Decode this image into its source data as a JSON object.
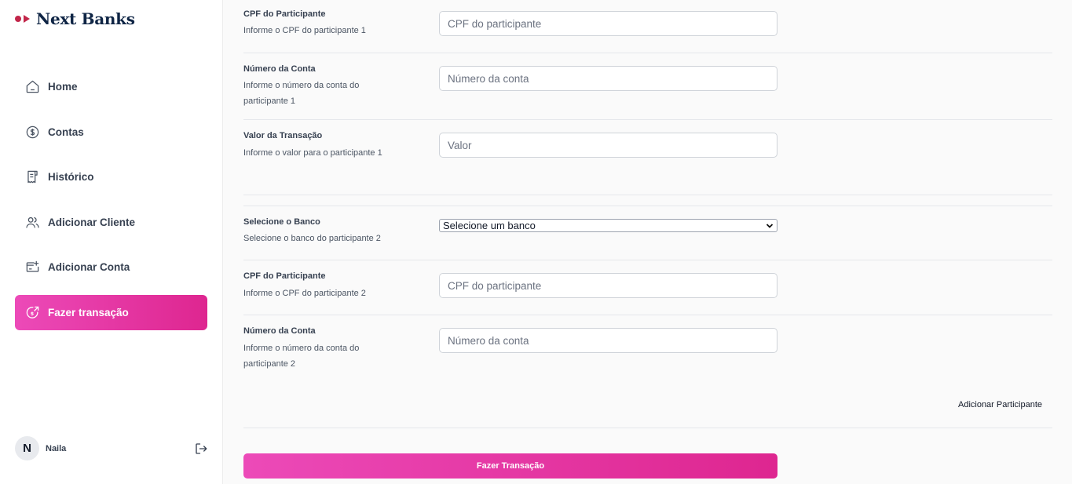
{
  "app": {
    "name": "Next Banks",
    "colors": {
      "accent": "#e33aa8",
      "brand_mark": "#c2264a",
      "brand_text": "#0f2545"
    }
  },
  "sidebar": {
    "items": [
      {
        "label": "Home",
        "icon": "home-icon",
        "active": false
      },
      {
        "label": "Contas",
        "icon": "dollar-circle-icon",
        "active": false
      },
      {
        "label": "Histórico",
        "icon": "receipt-icon",
        "active": false
      },
      {
        "label": "Adicionar Cliente",
        "icon": "users-icon",
        "active": false
      },
      {
        "label": "Adicionar Conta",
        "icon": "card-add-icon",
        "active": false
      },
      {
        "label": "Fazer transação",
        "icon": "coin-send-icon",
        "active": true
      }
    ],
    "user": {
      "initial": "N",
      "name": "Naila"
    },
    "logout_icon": "logout-icon"
  },
  "form": {
    "participant1": {
      "cpf": {
        "title": "CPF do Participante",
        "desc": "Informe o CPF do participante 1",
        "placeholder": "CPF do participante"
      },
      "account": {
        "title": "Número da Conta",
        "desc": "Informe o número da conta do participante 1",
        "placeholder": "Número da conta"
      },
      "value": {
        "title": "Valor da Transação",
        "desc": "Informe o valor para o participante 1",
        "placeholder": "Valor"
      }
    },
    "participant2": {
      "bank": {
        "title": "Selecione o Banco",
        "desc": "Selecione o banco do participante 2",
        "selected": "Selecione um banco"
      },
      "cpf": {
        "title": "CPF do Participante",
        "desc": "Informe o CPF do participante 2",
        "placeholder": "CPF do participante"
      },
      "account": {
        "title": "Número da Conta",
        "desc": "Informe o número da conta do participante 2",
        "placeholder": "Número da conta"
      }
    },
    "add_participant_label": "Adicionar Participante",
    "submit_label": "Fazer Transação"
  }
}
